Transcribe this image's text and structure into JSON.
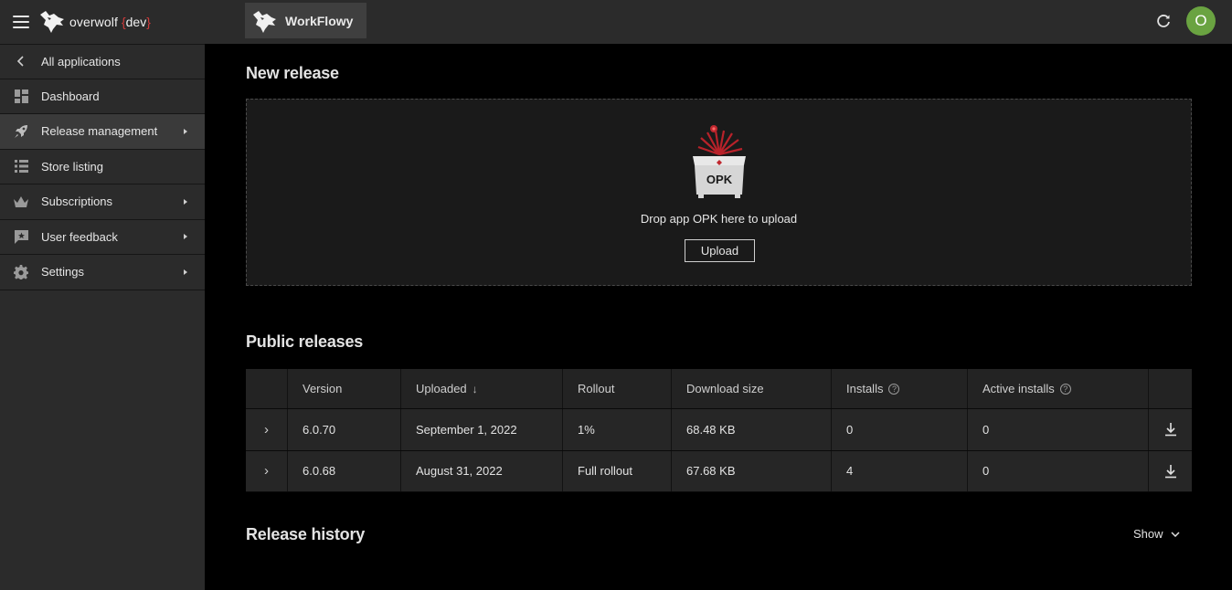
{
  "brand": {
    "name": "overwolf",
    "suffix": "dev"
  },
  "sidebar": {
    "items": [
      {
        "label": "All applications",
        "icon": "chevron-left-icon"
      },
      {
        "label": "Dashboard",
        "icon": "dashboard-icon"
      },
      {
        "label": "Release management",
        "icon": "rocket-icon"
      },
      {
        "label": "Store listing",
        "icon": "list-icon"
      },
      {
        "label": "Subscriptions",
        "icon": "crown-icon"
      },
      {
        "label": "User feedback",
        "icon": "feedback-icon"
      },
      {
        "label": "Settings",
        "icon": "gear-icon"
      }
    ]
  },
  "topbar": {
    "app_name": "WorkFlowy",
    "avatar_initial": "O",
    "avatar_color": "#6aa341"
  },
  "new_release": {
    "title": "New release",
    "illustration_text": "OPK",
    "drop_text": "Drop app OPK here to upload",
    "upload_label": "Upload"
  },
  "public_releases": {
    "title": "Public releases",
    "columns": [
      "Version",
      "Uploaded",
      "Rollout",
      "Download size",
      "Installs",
      "Active installs"
    ],
    "rows": [
      {
        "version": "6.0.70",
        "uploaded": "September 1, 2022",
        "rollout": "1%",
        "size": "68.48 KB",
        "installs": "0",
        "active": "0"
      },
      {
        "version": "6.0.68",
        "uploaded": "August 31, 2022",
        "rollout": "Full rollout",
        "size": "67.68 KB",
        "installs": "4",
        "active": "0"
      }
    ]
  },
  "release_history": {
    "title": "Release history",
    "toggle_label": "Show"
  },
  "colors": {
    "accent_red": "#d33b3b",
    "sidebar_bg": "#2b2b2b",
    "main_bg": "#000000"
  }
}
